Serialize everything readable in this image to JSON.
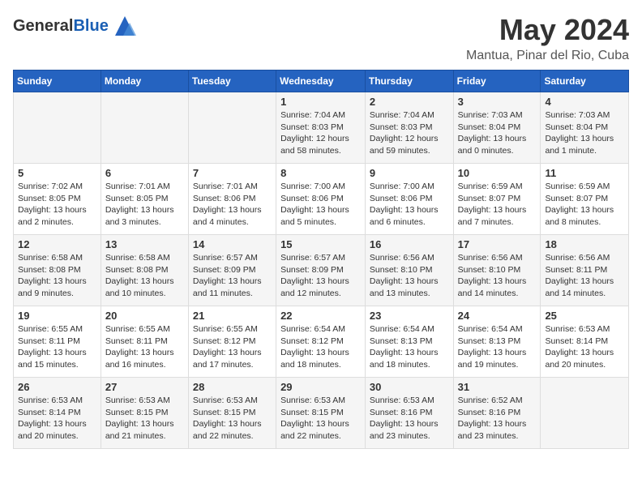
{
  "header": {
    "logo_general": "General",
    "logo_blue": "Blue",
    "month_title": "May 2024",
    "location": "Mantua, Pinar del Rio, Cuba"
  },
  "days_of_week": [
    "Sunday",
    "Monday",
    "Tuesday",
    "Wednesday",
    "Thursday",
    "Friday",
    "Saturday"
  ],
  "weeks": [
    [
      {
        "day": "",
        "info": ""
      },
      {
        "day": "",
        "info": ""
      },
      {
        "day": "",
        "info": ""
      },
      {
        "day": "1",
        "info": "Sunrise: 7:04 AM\nSunset: 8:03 PM\nDaylight: 12 hours and 58 minutes."
      },
      {
        "day": "2",
        "info": "Sunrise: 7:04 AM\nSunset: 8:03 PM\nDaylight: 12 hours and 59 minutes."
      },
      {
        "day": "3",
        "info": "Sunrise: 7:03 AM\nSunset: 8:04 PM\nDaylight: 13 hours and 0 minutes."
      },
      {
        "day": "4",
        "info": "Sunrise: 7:03 AM\nSunset: 8:04 PM\nDaylight: 13 hours and 1 minute."
      }
    ],
    [
      {
        "day": "5",
        "info": "Sunrise: 7:02 AM\nSunset: 8:05 PM\nDaylight: 13 hours and 2 minutes."
      },
      {
        "day": "6",
        "info": "Sunrise: 7:01 AM\nSunset: 8:05 PM\nDaylight: 13 hours and 3 minutes."
      },
      {
        "day": "7",
        "info": "Sunrise: 7:01 AM\nSunset: 8:06 PM\nDaylight: 13 hours and 4 minutes."
      },
      {
        "day": "8",
        "info": "Sunrise: 7:00 AM\nSunset: 8:06 PM\nDaylight: 13 hours and 5 minutes."
      },
      {
        "day": "9",
        "info": "Sunrise: 7:00 AM\nSunset: 8:06 PM\nDaylight: 13 hours and 6 minutes."
      },
      {
        "day": "10",
        "info": "Sunrise: 6:59 AM\nSunset: 8:07 PM\nDaylight: 13 hours and 7 minutes."
      },
      {
        "day": "11",
        "info": "Sunrise: 6:59 AM\nSunset: 8:07 PM\nDaylight: 13 hours and 8 minutes."
      }
    ],
    [
      {
        "day": "12",
        "info": "Sunrise: 6:58 AM\nSunset: 8:08 PM\nDaylight: 13 hours and 9 minutes."
      },
      {
        "day": "13",
        "info": "Sunrise: 6:58 AM\nSunset: 8:08 PM\nDaylight: 13 hours and 10 minutes."
      },
      {
        "day": "14",
        "info": "Sunrise: 6:57 AM\nSunset: 8:09 PM\nDaylight: 13 hours and 11 minutes."
      },
      {
        "day": "15",
        "info": "Sunrise: 6:57 AM\nSunset: 8:09 PM\nDaylight: 13 hours and 12 minutes."
      },
      {
        "day": "16",
        "info": "Sunrise: 6:56 AM\nSunset: 8:10 PM\nDaylight: 13 hours and 13 minutes."
      },
      {
        "day": "17",
        "info": "Sunrise: 6:56 AM\nSunset: 8:10 PM\nDaylight: 13 hours and 14 minutes."
      },
      {
        "day": "18",
        "info": "Sunrise: 6:56 AM\nSunset: 8:11 PM\nDaylight: 13 hours and 14 minutes."
      }
    ],
    [
      {
        "day": "19",
        "info": "Sunrise: 6:55 AM\nSunset: 8:11 PM\nDaylight: 13 hours and 15 minutes."
      },
      {
        "day": "20",
        "info": "Sunrise: 6:55 AM\nSunset: 8:11 PM\nDaylight: 13 hours and 16 minutes."
      },
      {
        "day": "21",
        "info": "Sunrise: 6:55 AM\nSunset: 8:12 PM\nDaylight: 13 hours and 17 minutes."
      },
      {
        "day": "22",
        "info": "Sunrise: 6:54 AM\nSunset: 8:12 PM\nDaylight: 13 hours and 18 minutes."
      },
      {
        "day": "23",
        "info": "Sunrise: 6:54 AM\nSunset: 8:13 PM\nDaylight: 13 hours and 18 minutes."
      },
      {
        "day": "24",
        "info": "Sunrise: 6:54 AM\nSunset: 8:13 PM\nDaylight: 13 hours and 19 minutes."
      },
      {
        "day": "25",
        "info": "Sunrise: 6:53 AM\nSunset: 8:14 PM\nDaylight: 13 hours and 20 minutes."
      }
    ],
    [
      {
        "day": "26",
        "info": "Sunrise: 6:53 AM\nSunset: 8:14 PM\nDaylight: 13 hours and 20 minutes."
      },
      {
        "day": "27",
        "info": "Sunrise: 6:53 AM\nSunset: 8:15 PM\nDaylight: 13 hours and 21 minutes."
      },
      {
        "day": "28",
        "info": "Sunrise: 6:53 AM\nSunset: 8:15 PM\nDaylight: 13 hours and 22 minutes."
      },
      {
        "day": "29",
        "info": "Sunrise: 6:53 AM\nSunset: 8:15 PM\nDaylight: 13 hours and 22 minutes."
      },
      {
        "day": "30",
        "info": "Sunrise: 6:53 AM\nSunset: 8:16 PM\nDaylight: 13 hours and 23 minutes."
      },
      {
        "day": "31",
        "info": "Sunrise: 6:52 AM\nSunset: 8:16 PM\nDaylight: 13 hours and 23 minutes."
      },
      {
        "day": "",
        "info": ""
      }
    ]
  ]
}
